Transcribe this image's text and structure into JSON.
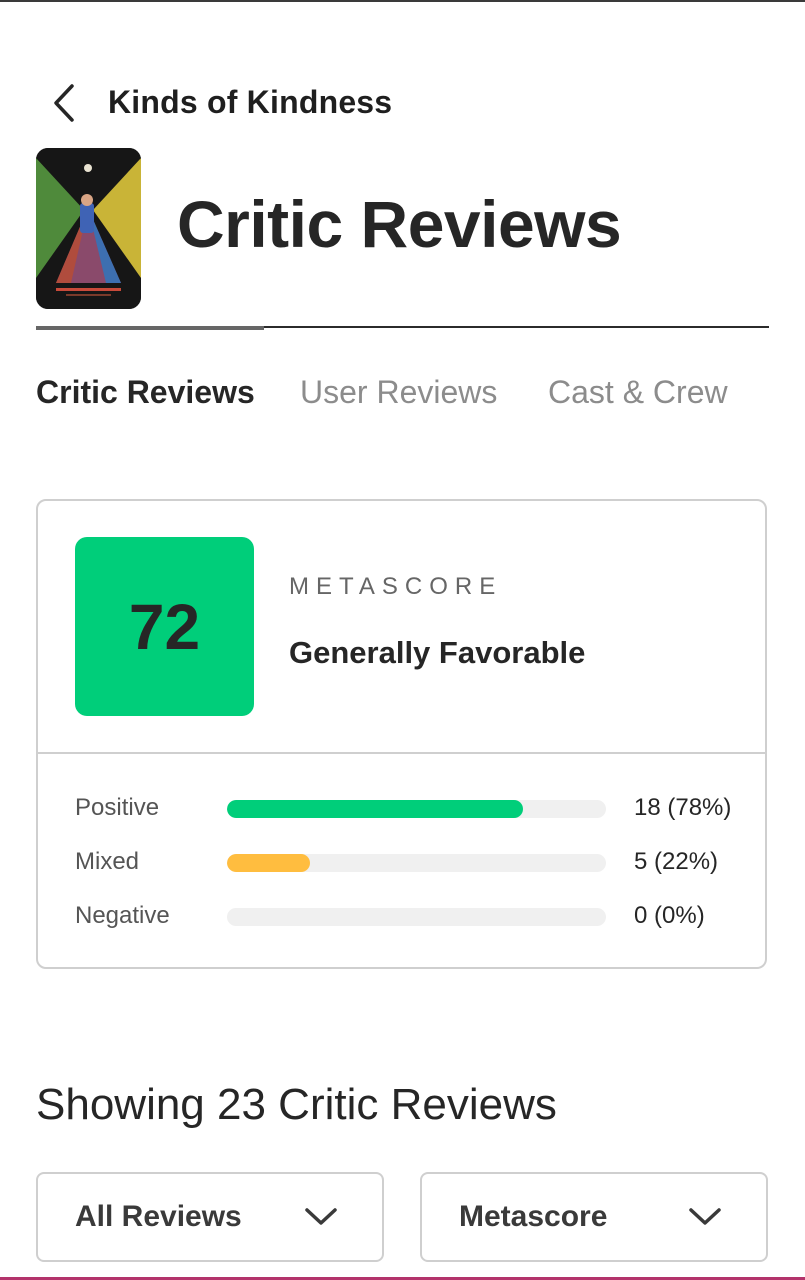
{
  "header": {
    "title": "Kinds of Kindness",
    "back_icon": "chevron-left-icon"
  },
  "page": {
    "title": "Critic Reviews"
  },
  "tabs": [
    {
      "label": "Critic Reviews",
      "active": true
    },
    {
      "label": "User Reviews",
      "active": false
    },
    {
      "label": "Cast & Crew",
      "active": false
    }
  ],
  "score": {
    "value": "72",
    "label": "METASCORE",
    "description": "Generally Favorable",
    "color": "#00ce7a"
  },
  "distribution": [
    {
      "label": "Positive",
      "count": "18 (78%)",
      "fraction": 0.78,
      "color": "#00ce7a"
    },
    {
      "label": "Mixed",
      "count": "5 (22%)",
      "fraction": 0.22,
      "color": "#ffbd3f"
    },
    {
      "label": "Negative",
      "count": "0 (0%)",
      "fraction": 0,
      "color": "#ff6874"
    }
  ],
  "showing": "Showing 23 Critic Reviews",
  "filters": {
    "reviews": {
      "selected": "All Reviews",
      "icon": "chevron-down-icon"
    },
    "sort": {
      "selected": "Metascore",
      "icon": "chevron-down-icon"
    }
  }
}
